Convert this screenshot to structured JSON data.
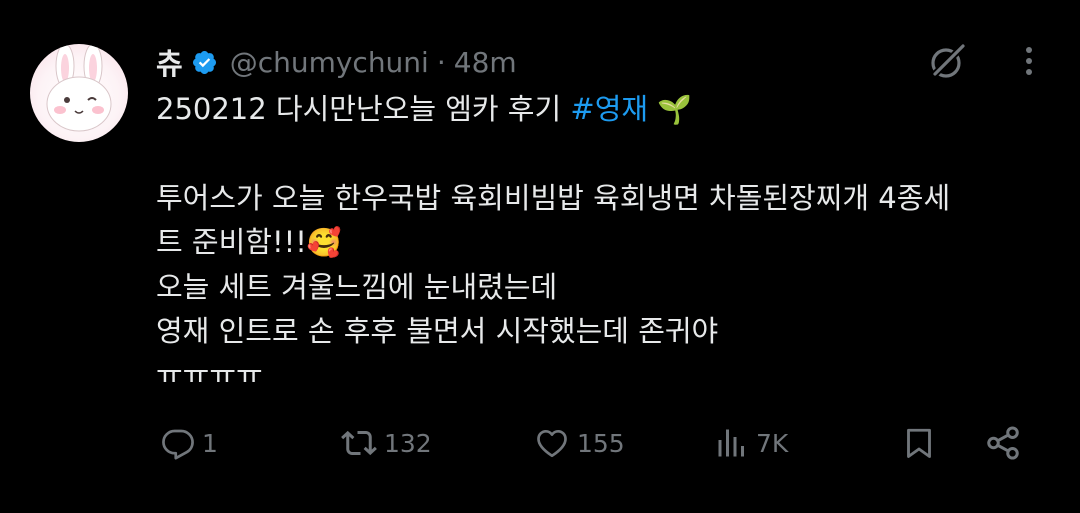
{
  "tweet": {
    "author": {
      "display_name": "츄",
      "handle": "@chumychuni",
      "separator": "·",
      "time": "48m",
      "avatar_icon": "bunny-avatar",
      "verified_icon": "verified-badge-icon"
    },
    "text": {
      "line1_prefix": "250212 다시만난오늘 엠카 후기 ",
      "hashtag": "#영재",
      "line1_emoji": "🌱",
      "line2": "투어스가 오늘 한우국밥 육회비빔밥 육회냉면 차돌된장찌개 4종세",
      "line3_prefix": "트 준비함!!!",
      "line3_emoji": "🥰",
      "line4": "오늘 세트 겨울느낌에 눈내렸는데",
      "line5": "영재 인트로 손 후후 불면서 시작했는데 존귀야",
      "line6": "ㅠㅠㅠㅠ"
    },
    "top_icons": [
      "grok-icon",
      "more-options-icon"
    ],
    "actions": {
      "reply": {
        "icon": "reply-icon",
        "count": "1"
      },
      "retweet": {
        "icon": "retweet-icon",
        "count": "132"
      },
      "like": {
        "icon": "like-heart-icon",
        "count": "155"
      },
      "views": {
        "icon": "views-chart-icon",
        "count": "7K"
      },
      "bookmark": {
        "icon": "bookmark-icon"
      },
      "share": {
        "icon": "share-icon"
      }
    },
    "colors": {
      "background": "#000000",
      "text": "#e7e9ea",
      "secondary": "#71767b",
      "accent": "#1d9bf0"
    }
  }
}
